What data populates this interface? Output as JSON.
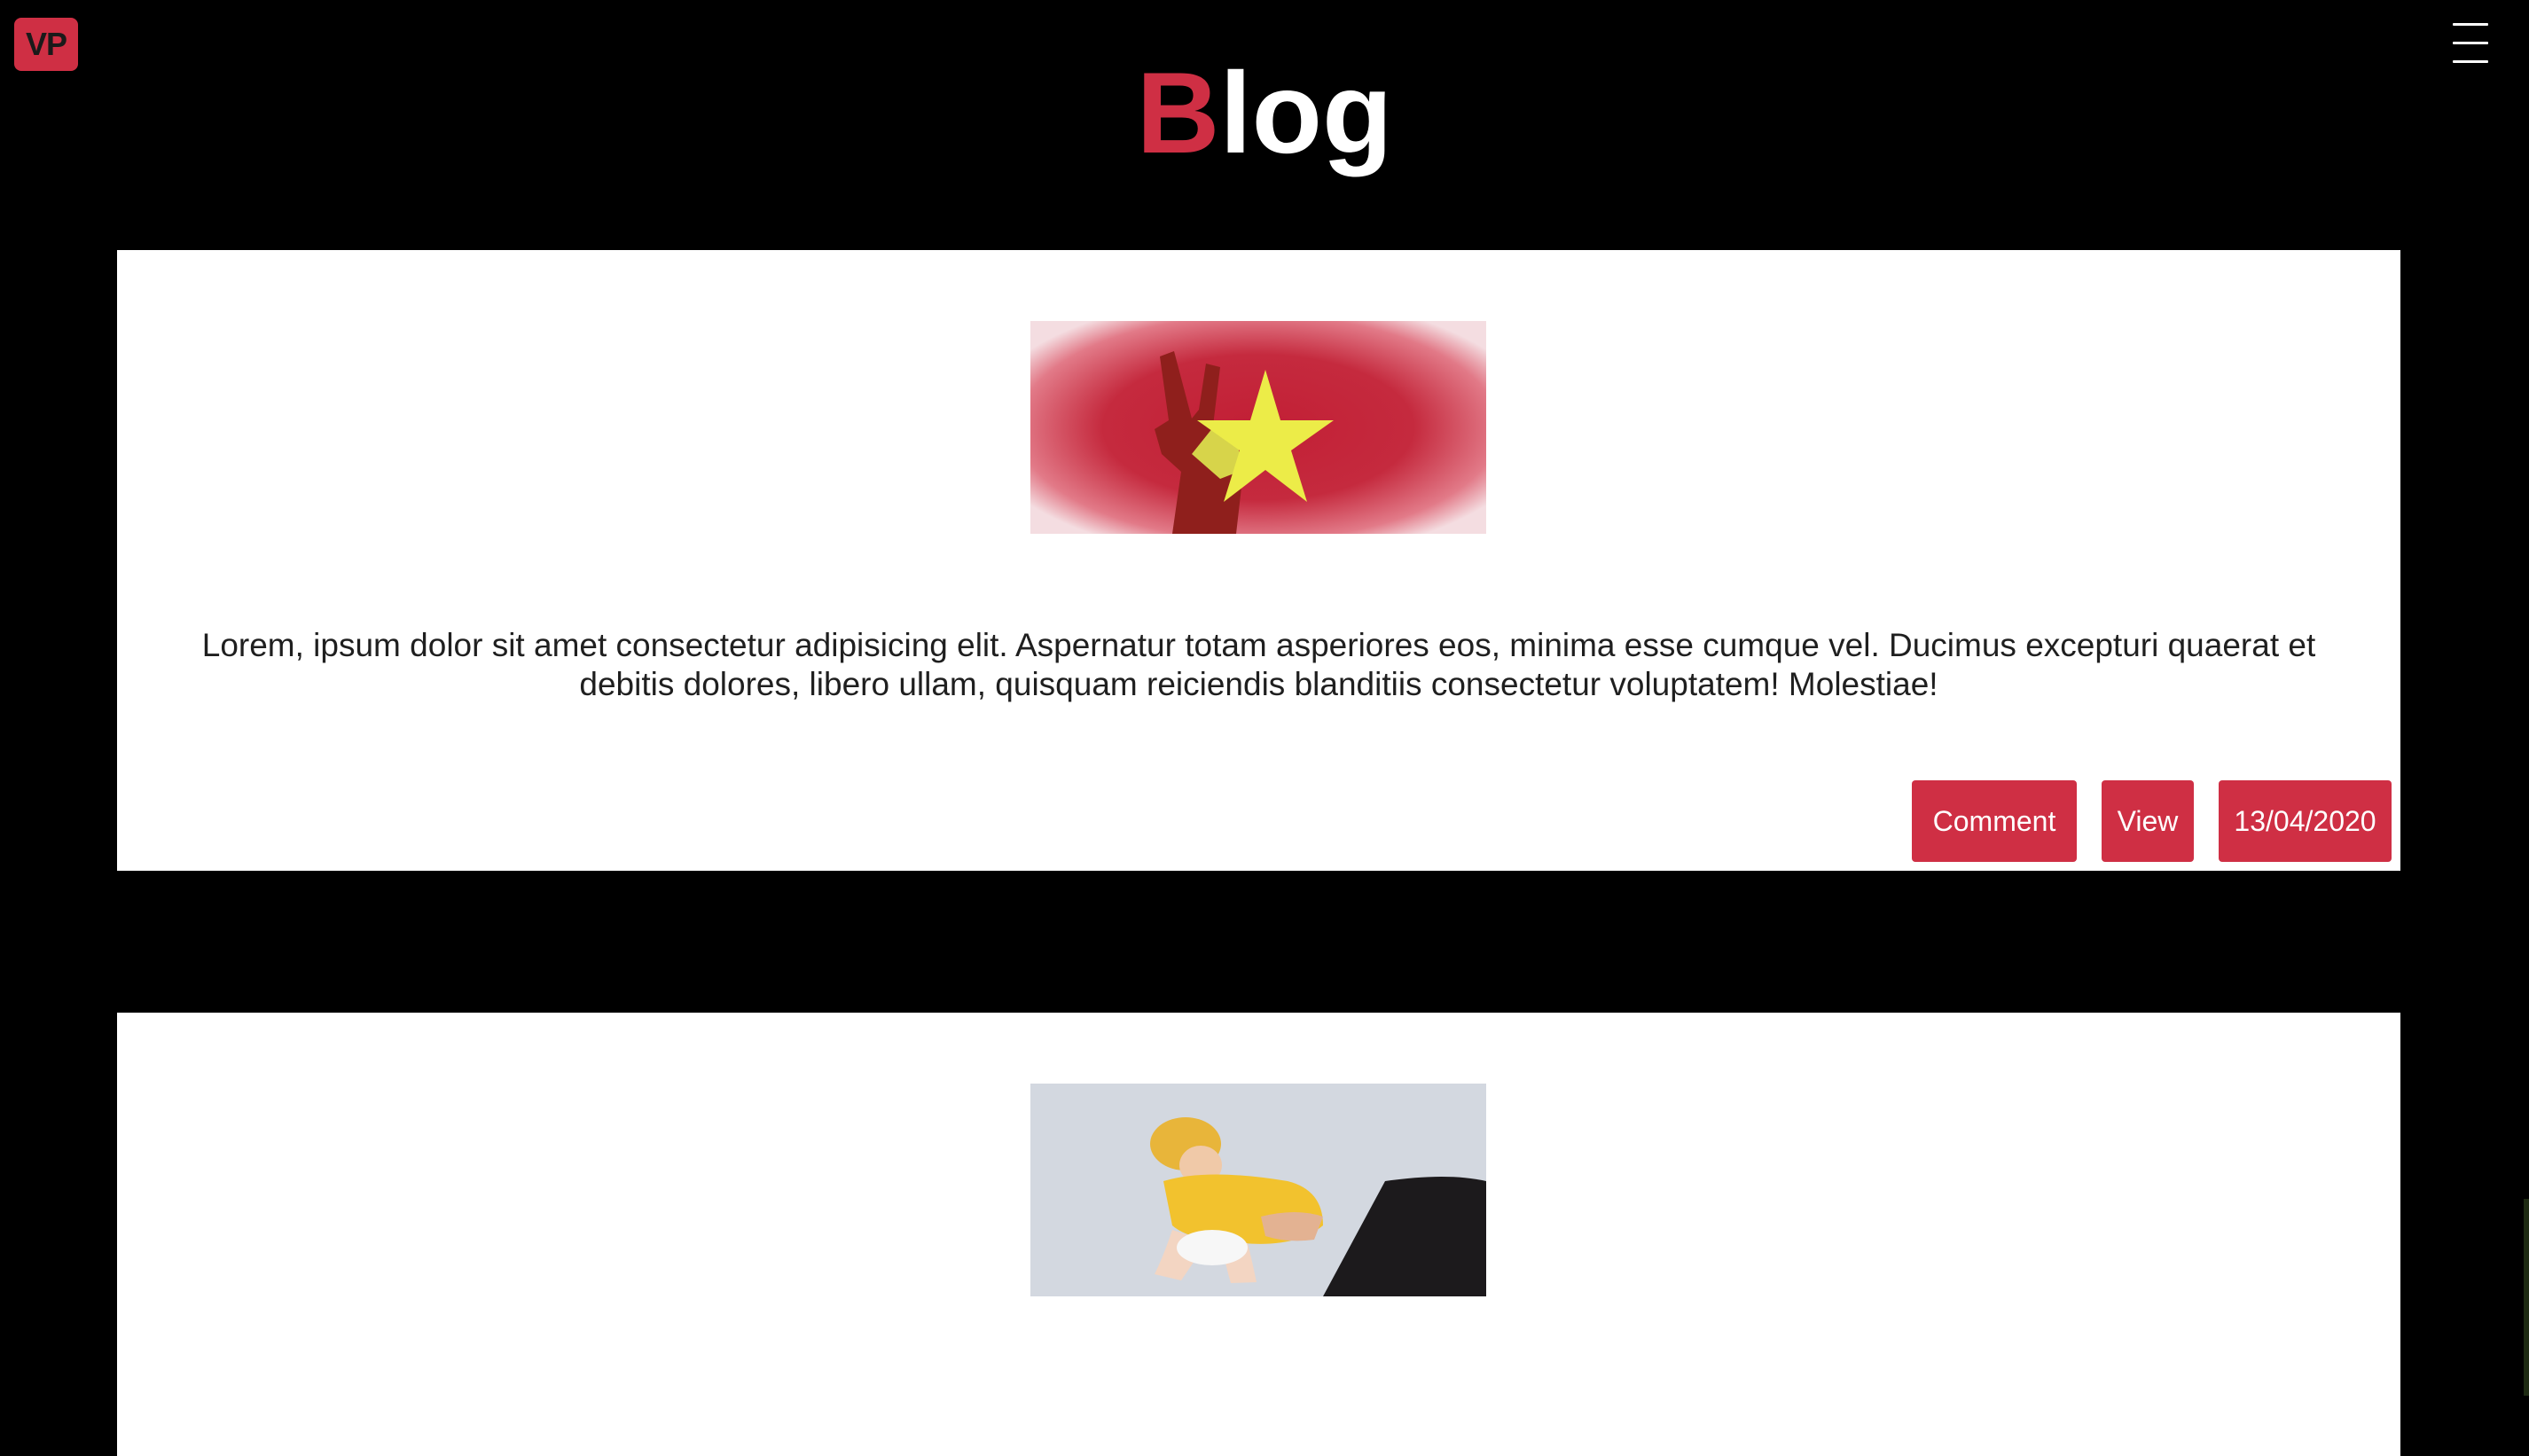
{
  "header": {
    "logo_text": "VP",
    "menu_icon": "hamburger-menu-icon",
    "title_first_letter": "B",
    "title_rest": "log"
  },
  "colors": {
    "background": "#000000",
    "accent": "#cf2f44",
    "card": "#ffffff",
    "text": "#1f1f1f"
  },
  "posts": [
    {
      "image": "vietnam-flag-peace-hand",
      "excerpt": "Lorem, ipsum dolor sit amet consectetur adipisicing elit. Aspernatur totam asperiores eos, minima esse cumque vel. Ducimus excepturi quaerat et debitis dolores, libero ullam, quisquam reiciendis blanditiis consectetur voluptatem! Molestiae!",
      "comment_label": "Comment",
      "view_label": "View",
      "date": "13/04/2020"
    },
    {
      "image": "baby-in-yellow-costume"
    }
  ]
}
